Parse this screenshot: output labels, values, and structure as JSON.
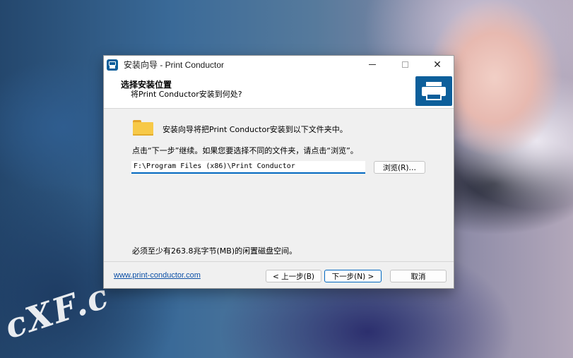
{
  "window": {
    "title": "安装向导 - Print Conductor",
    "controls": {
      "minimize": "",
      "maximize": "",
      "close": "✕"
    }
  },
  "header": {
    "title": "选择安装位置",
    "subtitle": "将Print Conductor安装到何处?"
  },
  "content": {
    "intro": "安装向导将把Print Conductor安装到以下文件夹中。",
    "hint": "点击“下一步”继续。如果您要选择不同的文件夹，请点击“浏览”。",
    "path_value": "F:\\Program Files (x86)\\Print Conductor",
    "browse_label": "浏览(R)…",
    "space_required": "必须至少有263.8兆字节(MB)的闲置磁盘空间。"
  },
  "footer": {
    "link": "www.print-conductor.com",
    "back_label": "< 上一步(B)",
    "next_label": "下一步(N) >",
    "cancel_label": "取消"
  },
  "colors": {
    "accent": "#0067c0",
    "brand": "#0d5f9b",
    "link": "#0b4fa6"
  }
}
